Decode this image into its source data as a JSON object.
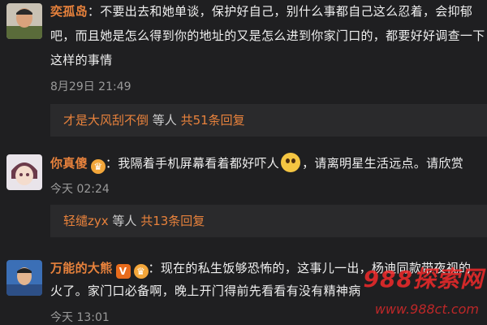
{
  "comments": [
    {
      "name": "奕孤岛",
      "line1": "：不要出去和她单谈，保护好自己，别什么事都自己这么忍着，会抑郁",
      "line2": "吧，而且她是怎么得到你的地址的又是怎么进到你家门口的，都要好好调查一下",
      "line3": "这样的事情",
      "time": "8月29日 21:49",
      "reply_user": "才是大风刮不倒",
      "reply_mid": " 等人 ",
      "reply_count": "共51条回复"
    },
    {
      "name": "你真傻",
      "line1a": "：我隔着手机屏幕看着都好吓人",
      "line1b": "，请离明星生活远点。请欣赏",
      "time": "今天 02:24",
      "reply_user": "轻缱zyx",
      "reply_mid": " 等人 ",
      "reply_count": "共13条回复"
    },
    {
      "name": "万能的大熊",
      "line1": "：现在的私生饭够恐怖的，这事儿一出，杨迪同款带夜视的",
      "line2": "火了。家门口必备啊，晚上开门得前先看看有没有精神病",
      "time": "今天 13:01"
    }
  ],
  "badges": {
    "v": "V",
    "crown": "♛"
  },
  "watermark": {
    "site": "988探索网",
    "url": "www.988ct.com"
  },
  "colors": {
    "name": "#e8823c",
    "background": "#1f1f21",
    "reply_bg": "#2a2a2c",
    "watermark": "#ff2b2b"
  }
}
